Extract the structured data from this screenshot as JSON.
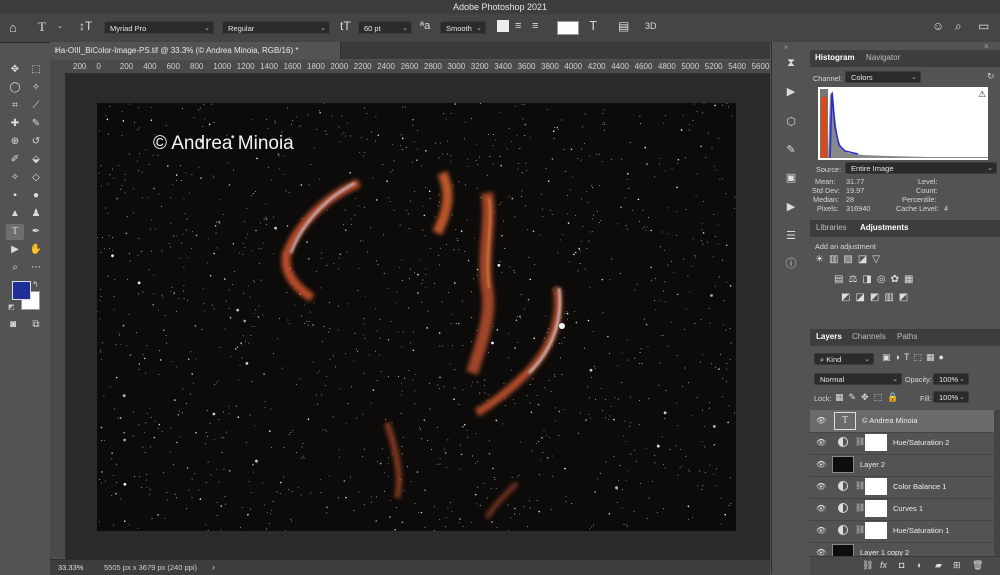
{
  "app": {
    "title": "Adobe Photoshop 2021"
  },
  "options_bar": {
    "font_family": "Myriad Pro",
    "font_style": "Regular",
    "font_size": "60 pt",
    "antialias": "Smooth",
    "three_d": "3D"
  },
  "document": {
    "tab_label": "Ha-OIII_BiColor-Image-PS.tif @ 33.3% (© Andrea Minoia, RGB/16) *",
    "watermark": "© Andrea Minoia"
  },
  "ruler": {
    "ticks": [
      "200",
      "0",
      "200",
      "400",
      "600",
      "800",
      "1000",
      "1200",
      "1400",
      "1600",
      "1800",
      "2000",
      "2200",
      "2400",
      "2600",
      "2800",
      "3000",
      "3200",
      "3400",
      "3600",
      "3800",
      "4000",
      "4200",
      "4400",
      "4600",
      "4800",
      "5000",
      "5200",
      "5400",
      "5600"
    ]
  },
  "status": {
    "zoom": "33.33%",
    "dims": "5505 px x 3679 px (240 ppi)",
    "arrow": "›"
  },
  "histogram": {
    "tabs": [
      "Histogram",
      "Navigator"
    ],
    "channel_label": "Channel:",
    "channel_value": "Colors",
    "source_label": "Source:",
    "source_value": "Entire Image",
    "stats": [
      {
        "k": "Mean:",
        "v": "31.77"
      },
      {
        "k": "Std Dev:",
        "v": "19.97"
      },
      {
        "k": "Median:",
        "v": "28"
      },
      {
        "k": "Pixels:",
        "v": "316940"
      }
    ],
    "stats_right": [
      {
        "k": "Level:",
        "v": ""
      },
      {
        "k": "Count:",
        "v": ""
      },
      {
        "k": "Percentile:",
        "v": ""
      },
      {
        "k": "Cache Level:",
        "v": "4"
      }
    ],
    "warning": "⚠"
  },
  "adjustments": {
    "tabs": [
      "Libraries",
      "Adjustments"
    ],
    "hint": "Add an adjustment"
  },
  "layers_panel": {
    "tabs": [
      "Layers",
      "Channels",
      "Paths"
    ],
    "filter_kind": "Kind",
    "blend_mode": "Normal",
    "opacity_label": "Opacity:",
    "opacity_value": "100%",
    "lock_label": "Lock:",
    "fill_label": "Fill:",
    "fill_value": "100%",
    "layers": [
      {
        "name": "© Andrea Minoia",
        "type": "text"
      },
      {
        "name": "Hue/Saturation 2",
        "type": "adjustment"
      },
      {
        "name": "Layer 2",
        "type": "pixel"
      },
      {
        "name": "Color Balance 1",
        "type": "adjustment"
      },
      {
        "name": "Curves 1",
        "type": "adjustment"
      },
      {
        "name": "Hue/Saturation 1",
        "type": "adjustment"
      },
      {
        "name": "Layer 1 copy 2",
        "type": "pixel"
      }
    ],
    "footer_icons": [
      "link-icon",
      "fx-icon",
      "mask-icon",
      "adjustment-icon",
      "folder-icon",
      "new-layer-icon",
      "trash-icon"
    ]
  },
  "colors": {
    "foreground": "#20309a",
    "background": "#ffffff",
    "panel_bg": "#535353",
    "canvas_bg": "#2a2a2a"
  }
}
